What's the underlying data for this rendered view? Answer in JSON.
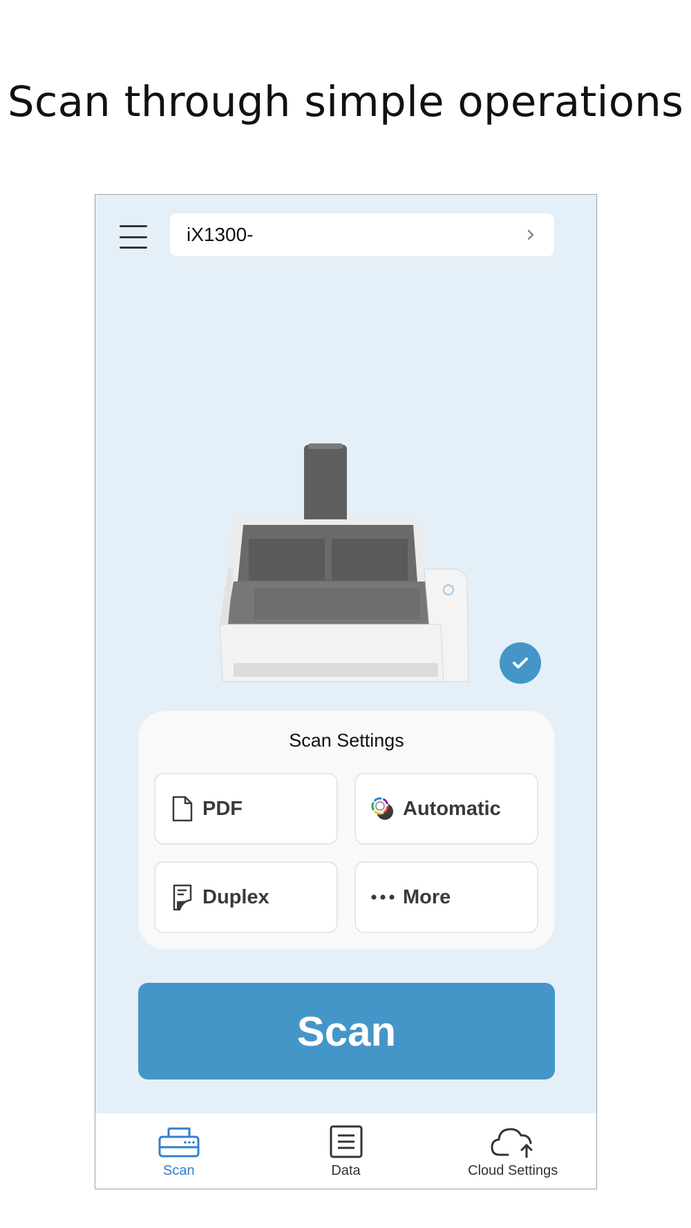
{
  "headline": "Scan through simple operations",
  "header": {
    "menu_icon": "hamburger-menu-icon",
    "device_name": "iX1300-",
    "chevron_icon": "chevron-right-icon"
  },
  "device": {
    "image": "scanner-image",
    "status_icon": "check-icon",
    "status_color": "#4496c8"
  },
  "scan_settings": {
    "title": "Scan Settings",
    "format": {
      "label": "PDF",
      "icon": "document-icon"
    },
    "color_mode": {
      "label": "Automatic",
      "icon": "color-wheel-icon"
    },
    "sides": {
      "label": "Duplex",
      "icon": "duplex-page-icon"
    },
    "more": {
      "label": "More",
      "icon": "ellipsis-icon"
    }
  },
  "scan_button": {
    "label": "Scan",
    "color": "#4596c8"
  },
  "tabs": [
    {
      "label": "Scan",
      "icon": "scanner-icon",
      "active": true
    },
    {
      "label": "Data",
      "icon": "data-list-icon",
      "active": false
    },
    {
      "label": "Cloud Settings",
      "icon": "cloud-upload-icon",
      "active": false
    }
  ],
  "colors": {
    "accent": "#2f7fd0",
    "background": "#e5eff7"
  }
}
